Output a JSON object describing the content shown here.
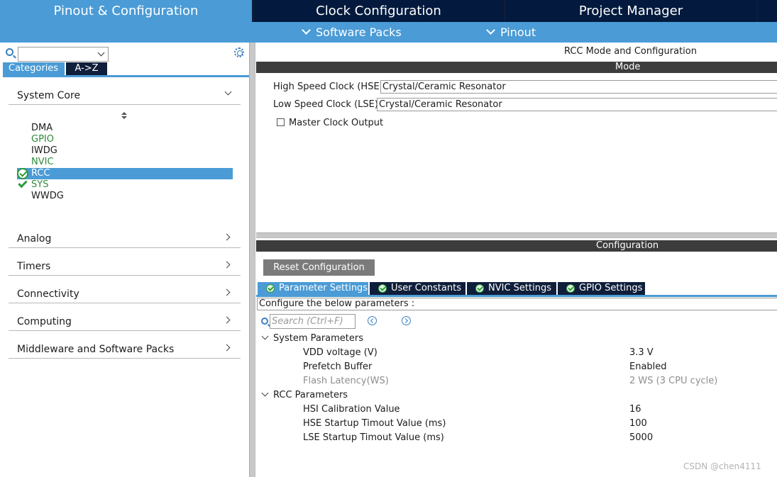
{
  "top_tabs": [
    {
      "label": "Pinout & Configuration"
    },
    {
      "label": "Clock Configuration"
    },
    {
      "label": "Project Manager"
    }
  ],
  "sub_menu": [
    {
      "label": "Software Packs"
    },
    {
      "label": "Pinout"
    }
  ],
  "left": {
    "category_tabs": [
      "Categories",
      "A->Z"
    ],
    "sections": {
      "system_core": "System Core",
      "analog": "Analog",
      "timers": "Timers",
      "connectivity": "Connectivity",
      "computing": "Computing",
      "middleware": "Middleware and Software Packs"
    },
    "peripherals": [
      {
        "label": "DMA",
        "state": "normal"
      },
      {
        "label": "GPIO",
        "state": "green"
      },
      {
        "label": "IWDG",
        "state": "normal"
      },
      {
        "label": "NVIC",
        "state": "green"
      },
      {
        "label": "RCC",
        "state": "selected-checked"
      },
      {
        "label": "SYS",
        "state": "green-checked"
      },
      {
        "label": "WWDG",
        "state": "normal"
      }
    ]
  },
  "right": {
    "title": "RCC Mode and Configuration",
    "mode_header": "Mode",
    "hse_label": "High Speed Clock (HSE)",
    "hse_value": "Crystal/Ceramic Resonator",
    "lse_label": "Low Speed Clock (LSE)",
    "lse_value": "Crystal/Ceramic Resonator",
    "mco_label": "Master Clock Output",
    "mco_checked": false,
    "config_header": "Configuration",
    "reset_button": "Reset Configuration",
    "config_tabs": [
      "Parameter Settings",
      "User Constants",
      "NVIC Settings",
      "GPIO Settings"
    ],
    "configure_text": "Configure the below parameters :",
    "search_placeholder": "Search (Ctrl+F)",
    "groups": {
      "system": {
        "label": "System Parameters",
        "params": [
          {
            "name": "VDD voltage (V)",
            "value": "3.3 V",
            "disabled": false
          },
          {
            "name": "Prefetch Buffer",
            "value": "Enabled",
            "disabled": false
          },
          {
            "name": "Flash Latency(WS)",
            "value": "2 WS (3 CPU cycle)",
            "disabled": true
          }
        ]
      },
      "rcc": {
        "label": "RCC Parameters",
        "params": [
          {
            "name": "HSI Calibration Value",
            "value": "16",
            "disabled": false
          },
          {
            "name": "HSE Startup Timout Value (ms)",
            "value": "100",
            "disabled": false
          },
          {
            "name": "LSE Startup Timout Value (ms)",
            "value": "5000",
            "disabled": false
          }
        ]
      }
    }
  },
  "watermark": "CSDN @chen4111",
  "colors": {
    "accent_blue": "#4a9bd6",
    "navy": "#0f1e3a",
    "ok_green": "#2e9a3e",
    "header_dark": "#3c3c3c"
  }
}
